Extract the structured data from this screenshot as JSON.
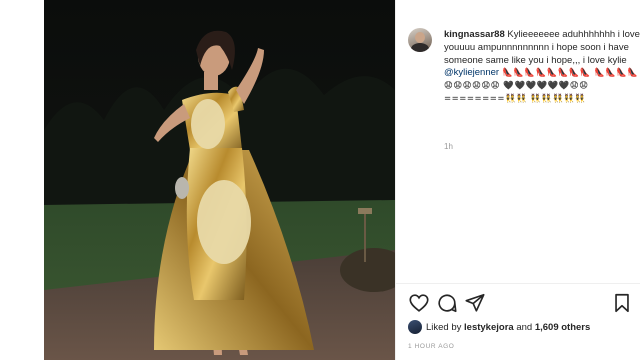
{
  "post": {
    "username": "kingnassar88",
    "caption_line1": " Kylieeeeeee aduhhhhhhh i love youuuu ampunnnnnnnnn i hope soon i have someone same like you i hope,,, i love kylie ",
    "mention": "@kyliejenner",
    "caption_emoji1": " 👠👠👠👠👠👠👠👠 👠👠👠👠😧😧😧😧😧😧 🖤🖤🖤🖤🖤🖤😧😧========👯👯 👯👯👯👯👯",
    "time_small": "1h"
  },
  "actions": {
    "like_icon": "heart-outline-icon",
    "comment_icon": "comment-icon",
    "share_icon": "paper-plane-icon",
    "save_icon": "bookmark-icon"
  },
  "likes": {
    "prefix": "Liked by ",
    "user": "lestykejora",
    "middle": " and ",
    "count": "1,609 others"
  },
  "timestamp": "1 HOUR AGO",
  "colors": {
    "mention": "#003569",
    "muted": "#999999",
    "dress_gold": "#c9a64a",
    "blur_patch": "#e8d9a8"
  }
}
